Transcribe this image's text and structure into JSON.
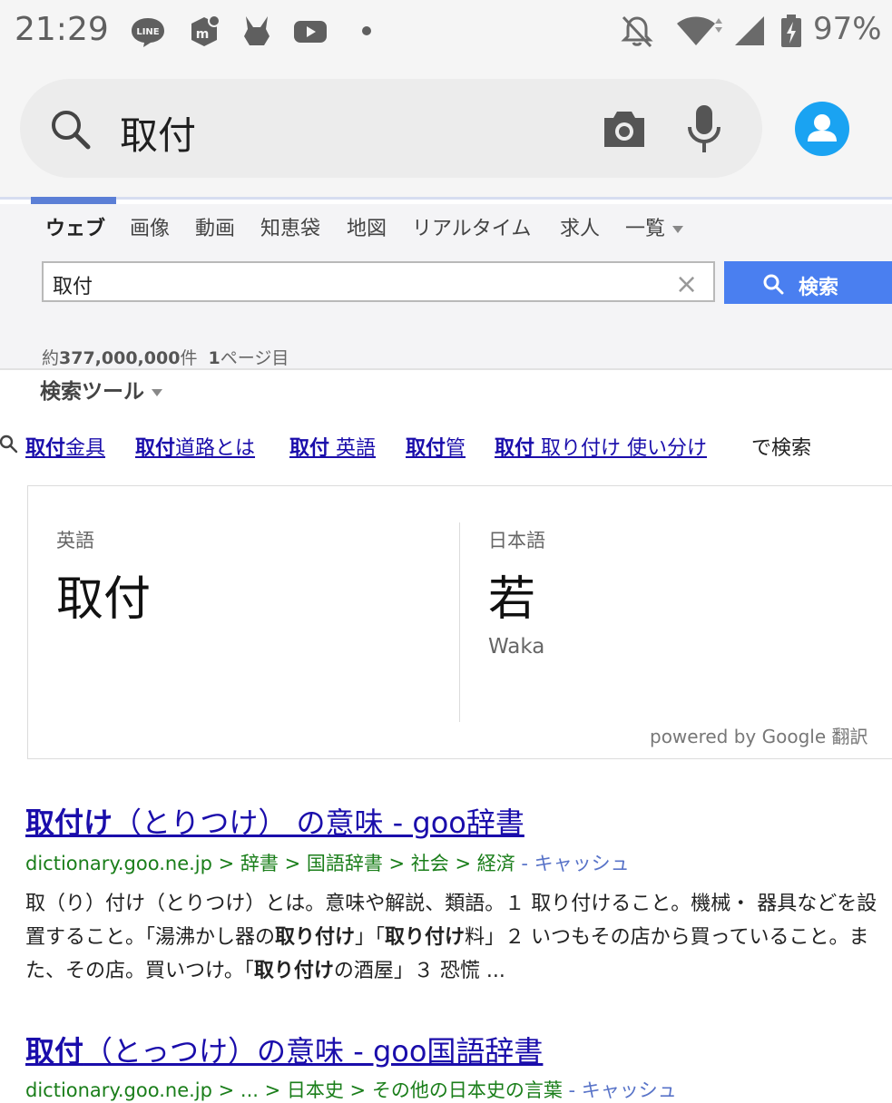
{
  "status_bar": {
    "time": "21:29",
    "battery": "97%",
    "app_icons": [
      "line-icon",
      "m-app-icon",
      "pikachu-icon",
      "youtube-icon",
      "dot-icon"
    ],
    "system_icons": [
      "notifications-off-icon",
      "wifi-icon",
      "signal-icon",
      "battery-icon"
    ]
  },
  "search_bar": {
    "query": "取付"
  },
  "tabs": [
    {
      "label": "ウェブ",
      "active": true
    },
    {
      "label": "画像"
    },
    {
      "label": "動画"
    },
    {
      "label": "知恵袋"
    },
    {
      "label": "地図"
    },
    {
      "label": "リアルタイム"
    },
    {
      "label": "求人"
    },
    {
      "label": "一覧"
    }
  ],
  "search_box": {
    "value": "取付",
    "clear_symbol": "×",
    "button_label": "検索"
  },
  "results_info": {
    "prefix": "約",
    "count": "377,000,000",
    "suffix": "件",
    "page_num": "1",
    "page_suffix": "ページ目"
  },
  "tools_label": "検索ツール",
  "related": {
    "items": [
      {
        "bold": "取付",
        "rest": "金具"
      },
      {
        "bold": "取付",
        "rest": "道路とは"
      },
      {
        "bold": "取付",
        "rest": " 英語"
      },
      {
        "bold": "取付",
        "rest": "管"
      },
      {
        "bold": "取付",
        "rest": " 取り付け 使い分け"
      }
    ],
    "suffix": "で検索"
  },
  "translation": {
    "source_lang": "英語",
    "source_text": "取付",
    "target_lang": "日本語",
    "target_text": "若",
    "romanization": "Waka",
    "powered_by": "powered by Google 翻訳"
  },
  "results": [
    {
      "title_bold": "取付け",
      "title_rest": "（とりつけ） の意味 - goo辞書",
      "url": "dictionary.goo.ne.jp > 辞書 > 国語辞書 > 社会 > 経済",
      "cache": " - キャッシュ",
      "snippet": [
        {
          "t": "取（り）付け（とりつけ）とは。意味や解説、類語。１ 取り付けること。機械・ 器具などを設置すること。「湯沸かし器の"
        },
        {
          "t": "取り付け",
          "b": true
        },
        {
          "t": "」「"
        },
        {
          "t": "取り付け",
          "b": true
        },
        {
          "t": "料」２ いつもその店から買っていること。また、その店。買いつけ。「"
        },
        {
          "t": "取り付け",
          "b": true
        },
        {
          "t": "の酒屋」３ 恐慌 ..."
        }
      ]
    },
    {
      "title_bold": "取付",
      "title_rest": "（とっつけ）の意味 - goo国語辞書",
      "url": "dictionary.goo.ne.jp > ... > 日本史 > その他の日本史の言葉",
      "cache": " - キャッシュ"
    }
  ]
}
